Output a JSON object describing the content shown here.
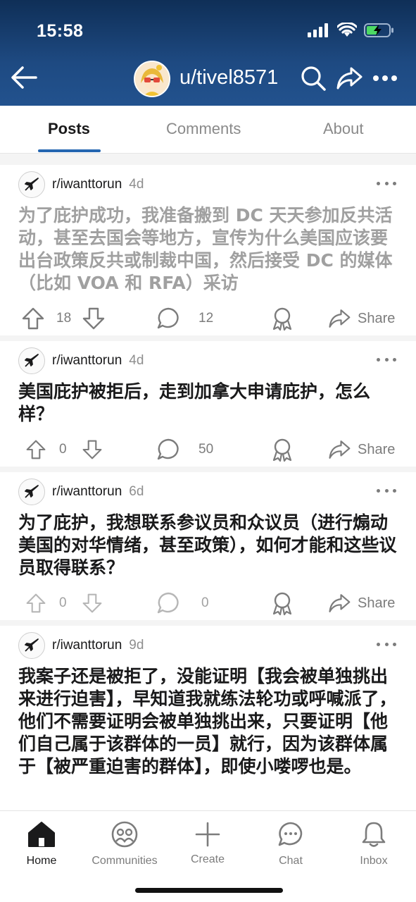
{
  "status_bar": {
    "time": "15:58"
  },
  "header": {
    "username": "u/tivel8571"
  },
  "tabs": [
    {
      "label": "Posts",
      "active": true
    },
    {
      "label": "Comments",
      "active": false
    },
    {
      "label": "About",
      "active": false
    }
  ],
  "posts": [
    {
      "subreddit": "r/iwanttorun",
      "age": "4d",
      "title": "为了庇护成功，我准备搬到 DC 天天参加反共活动，甚至去国会等地方，宣传为什么美国应该要出台政策反共或制裁中国，然后接受 DC 的媒体（比如 VOA 和 RFA）采访",
      "faded": true,
      "votes": "18",
      "comments": "12",
      "share": "Share"
    },
    {
      "subreddit": "r/iwanttorun",
      "age": "4d",
      "title": "美国庇护被拒后，走到加拿大申请庇护，怎么样？",
      "faded": false,
      "votes": "0",
      "comments": "50",
      "share": "Share"
    },
    {
      "subreddit": "r/iwanttorun",
      "age": "6d",
      "title": "为了庇护，我想联系参议员和众议员（进行煽动美国的对华情绪，甚至政策），如何才能和这些议员取得联系？",
      "faded": false,
      "votes": "0",
      "comments": "0",
      "share": "Share"
    },
    {
      "subreddit": "r/iwanttorun",
      "age": "9d",
      "title": "我案子还是被拒了，没能证明【我会被单独挑出来进行迫害】，早知道我就练法轮功或呼喊派了，他们不需要证明会被单独挑出来，只要证明【他们自己属于该群体的一员】就行，因为该群体属于【被严重迫害的群体】，即使小喽啰也是。",
      "faded": false
    }
  ],
  "bottom_nav": [
    {
      "label": "Home",
      "icon": "home-icon",
      "active": true
    },
    {
      "label": "Communities",
      "icon": "communities-icon",
      "active": false
    },
    {
      "label": "Create",
      "icon": "plus-icon",
      "active": false
    },
    {
      "label": "Chat",
      "icon": "chat-icon",
      "active": false
    },
    {
      "label": "Inbox",
      "icon": "bell-icon",
      "active": false
    }
  ],
  "colors": {
    "header": "#1e4a82",
    "tab_accent": "#2466b1",
    "muted": "#7c7c7c"
  }
}
